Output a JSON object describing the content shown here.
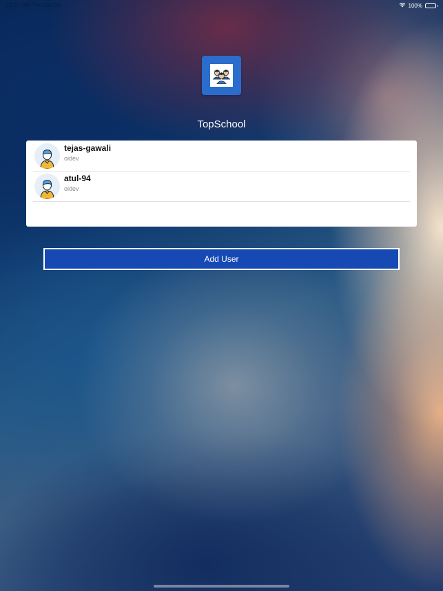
{
  "status_bar": {
    "time_date": "12:17 AM   Thu Oct 29",
    "battery": "100%",
    "wifi_icon": "wifi-icon",
    "battery_icon": "battery-icon"
  },
  "app": {
    "icon": "students-group-icon",
    "icon_background": "#2a6dcc",
    "title": "TopSchool"
  },
  "users": [
    {
      "name": "tejas-gawali",
      "org": "oidev",
      "avatar_icon": "user-avatar-icon"
    },
    {
      "name": "atul-94",
      "org": "oidev",
      "avatar_icon": "user-avatar-icon"
    }
  ],
  "actions": {
    "add_user_label": "Add User",
    "add_user_color": "#1649b4"
  }
}
